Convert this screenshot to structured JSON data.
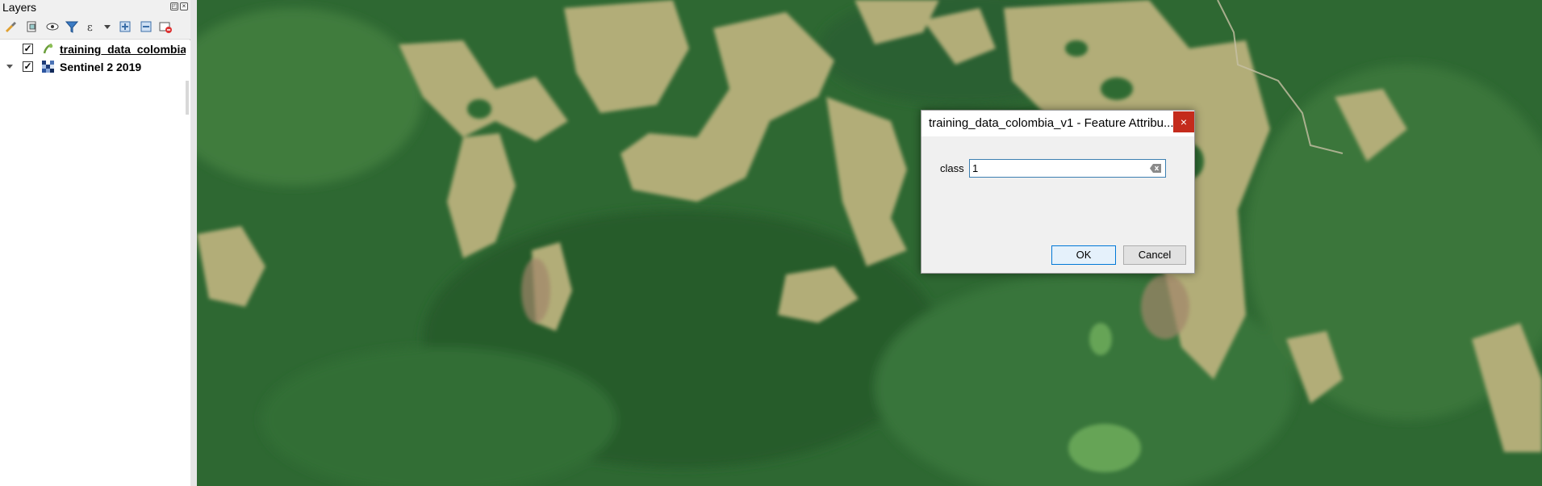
{
  "layers_panel": {
    "title": "Layers",
    "layers": [
      {
        "name": "training_data_colombia",
        "checked": true,
        "selected": true,
        "icon": "line-layer-icon"
      },
      {
        "name": "Sentinel 2 2019",
        "checked": true,
        "selected": false,
        "icon": "raster-layer-icon"
      }
    ],
    "check_glyph": "✓"
  },
  "dialog": {
    "title": "training_data_colombia_v1 - Feature Attribu...",
    "close_glyph": "×",
    "field_label": "class",
    "field_value": "1",
    "ok_label": "OK",
    "cancel_label": "Cancel"
  },
  "colors": {
    "forest_dark": "#2b5f2f",
    "forest_mid": "#3e7a3f",
    "clearing": "#b4b07a",
    "close_red": "#c42b1c",
    "focus_blue": "#3c7fb1"
  }
}
